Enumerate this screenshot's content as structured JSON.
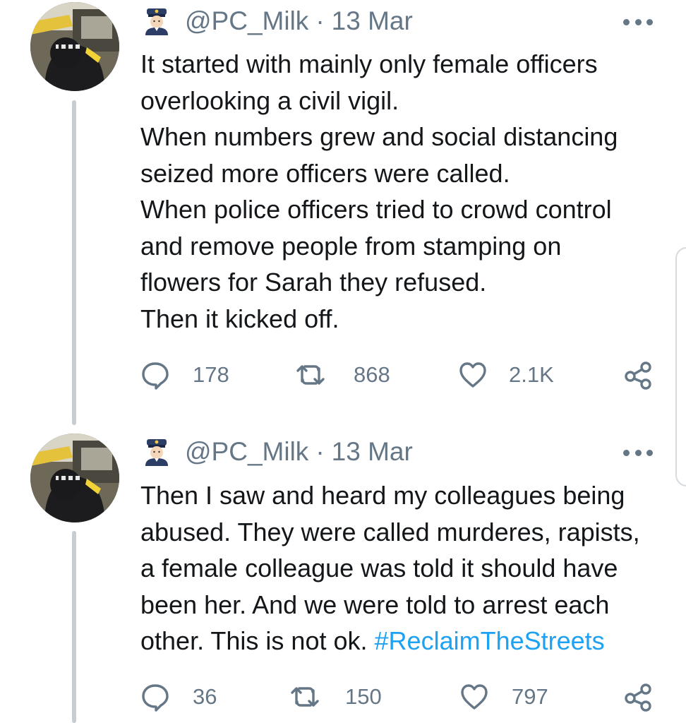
{
  "tweets": [
    {
      "handle": "@PC_Milk",
      "separator": "·",
      "date": "13 Mar",
      "lines": [
        "It started with mainly only female officers",
        "overlooking a civil vigil.",
        "When numbers grew and social distancing",
        "seized more officers were called.",
        "When police officers tried to crowd control",
        "and remove people from stamping on",
        "flowers for Sarah they refused.",
        "Then it kicked off."
      ],
      "replies": "178",
      "retweets": "868",
      "likes": "2.1K"
    },
    {
      "handle": "@PC_Milk",
      "separator": "·",
      "date": "13 Mar",
      "lines": [
        "Then I saw and heard my colleagues being",
        "abused. They were called murderes, rapists,",
        "a female colleague was told it should have",
        "been her. And we were told to arrest each"
      ],
      "last_line_text": "other. This is not ok.",
      "hashtag": "#ReclaimTheStreets",
      "replies": "36",
      "retweets": "150",
      "likes": "797"
    }
  ],
  "icons": {
    "badge": "police-officer-emoji-icon",
    "more": "more-dots-icon",
    "reply": "reply-bubble-icon",
    "retweet": "retweet-icon",
    "like": "heart-icon",
    "share": "share-icon"
  },
  "colors": {
    "text": "#14171a",
    "muted": "#657786",
    "link": "#1da1f2",
    "thread_line": "#c6ced4"
  }
}
